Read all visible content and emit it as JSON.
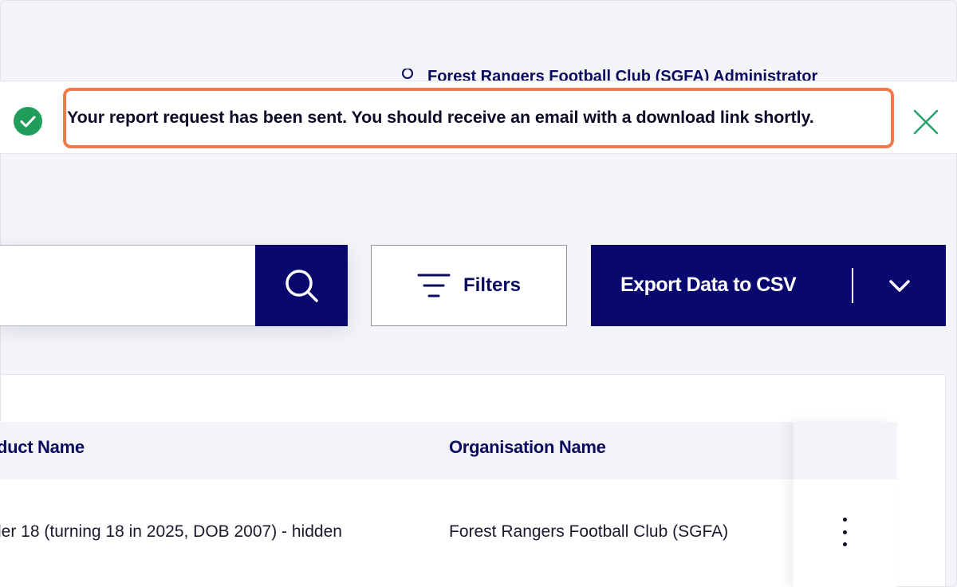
{
  "header": {
    "user_icon": "user-icon",
    "user_label": "Forest Rangers Football Club (SGFA) Administrator"
  },
  "toast": {
    "status_icon": "check-circle-icon",
    "message": "Your report request has been sent. You should receive an email with a download link shortly.",
    "close_icon": "close-icon",
    "colors": {
      "success": "#1e9e5a",
      "highlight_border": "#f07b4a",
      "close": "#22a36a"
    }
  },
  "toolbar": {
    "search": {
      "placeholder": "",
      "value": "",
      "icon": "search-icon"
    },
    "filters_label": "Filters",
    "filters_icon": "filter-icon",
    "export_label": "Export Data to CSV",
    "export_menu_icon": "chevron-down-icon"
  },
  "table": {
    "columns": [
      "duct Name",
      "Organisation Name"
    ],
    "rows": [
      {
        "product": "ler 18 (turning 18 in 2025, DOB 2007) - hidden",
        "organisation": "Forest Rangers Football Club (SGFA)",
        "actions_icon": "more-vertical-icon"
      }
    ]
  },
  "colors": {
    "brand_navy": "#09086f",
    "text_navy": "#0a0a5e"
  }
}
